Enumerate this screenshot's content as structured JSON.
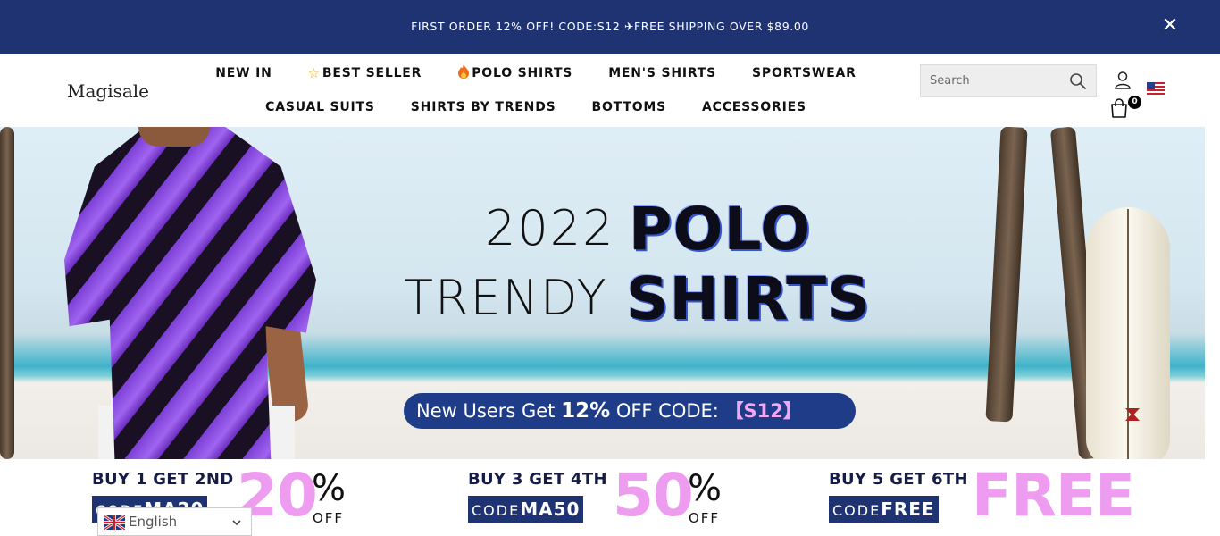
{
  "announcement": {
    "text": "FIRST ORDER 12% OFF!  CODE:S12 ✈FREE SHIPPING OVER $89.00",
    "close_icon": "close-icon",
    "background": "#1f3373"
  },
  "header": {
    "logo": "Magisale",
    "nav_row1": [
      {
        "label": "NEW IN",
        "icon": ""
      },
      {
        "label": "BEST SELLER",
        "icon": "star-icon"
      },
      {
        "label": "POLO SHIRTS",
        "icon": "fire-icon"
      },
      {
        "label": "MEN'S SHIRTS",
        "icon": ""
      },
      {
        "label": "SPORTSWEAR",
        "icon": ""
      }
    ],
    "nav_row2": [
      {
        "label": "CASUAL SUITS"
      },
      {
        "label": "SHIRTS BY TRENDS"
      },
      {
        "label": "BOTTOMS"
      },
      {
        "label": "ACCESSORIES"
      }
    ],
    "search": {
      "placeholder": "Search",
      "icon": "search-icon"
    },
    "account_icon": "user-icon",
    "flag_icon": "us-flag-icon",
    "cart": {
      "icon": "cart-icon",
      "count": "0"
    }
  },
  "hero": {
    "line1_light": "2022",
    "line1_bold": "POLO",
    "line2_light": "TRENDY",
    "line2_bold": "SHIRTS",
    "promo_prefix": "New Users Get ",
    "promo_bold": "12%",
    "promo_mid": " OFF  CODE: ",
    "promo_code": "【S12】"
  },
  "deals": [
    {
      "top": "BUY 1 GET 2ND",
      "code_prefix": "CODE",
      "code": "MA20",
      "big": "20",
      "pct": "%",
      "off": "OFF"
    },
    {
      "top": "BUY 3 GET 4TH",
      "code_prefix": "CODE",
      "code": "MA50",
      "big": "50",
      "pct": "%",
      "off": "OFF"
    },
    {
      "top": "BUY 5 GET 6TH",
      "code_prefix": "CODE",
      "code": "FREE",
      "big": "FREE",
      "pct": "",
      "off": ""
    }
  ],
  "language": {
    "label": "English",
    "flag_icon": "uk-flag-icon",
    "chevron_icon": "chevron-down-icon"
  },
  "colors": {
    "navy": "#1f3373",
    "pink": "#ee9cf0"
  }
}
